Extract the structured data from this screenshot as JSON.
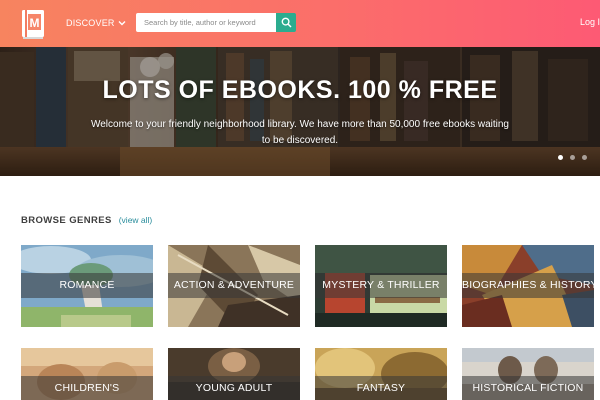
{
  "header": {
    "discover_label": "DISCOVER",
    "search_placeholder": "Search by title, author or keyword",
    "login_label": "Log In"
  },
  "hero": {
    "title": "LOTS OF EBOOKS. 100 % FREE",
    "subtitle": "Welcome to your friendly neighborhood library. We have more than 50,000 free ebooks waiting to be discovered."
  },
  "genres": {
    "heading": "BROWSE GENRES",
    "view_all": "(view all)",
    "tiles": [
      {
        "label": "ROMANCE"
      },
      {
        "label": "ACTION & ADVENTURE"
      },
      {
        "label": "MYSTERY & THRILLER"
      },
      {
        "label": "BIOGRAPHIES & HISTORY"
      },
      {
        "label": "CHILDREN'S"
      },
      {
        "label": "YOUNG ADULT"
      },
      {
        "label": "FANTASY"
      },
      {
        "label": "HISTORICAL FICTION"
      }
    ]
  },
  "colors": {
    "header_gradient_start": "#f7845f",
    "header_gradient_end": "#fd5a74",
    "search_button": "#2bac8f",
    "link": "#2a8d9c"
  },
  "icons": {
    "logo": "book-logo-icon",
    "search": "search-icon",
    "discover": "chevron-down-icon"
  }
}
